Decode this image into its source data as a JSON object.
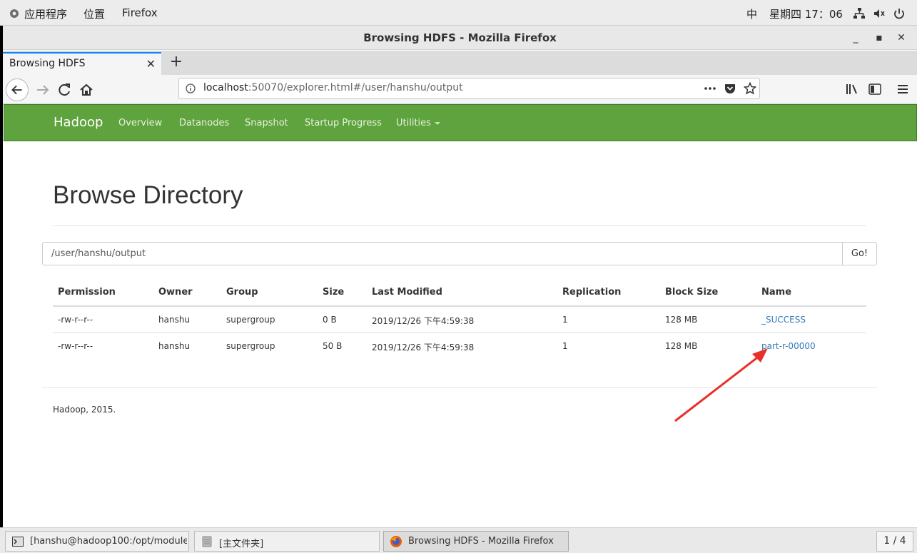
{
  "topbar": {
    "applications": "应用程序",
    "places": "位置",
    "firefox": "Firefox",
    "input_method": "中",
    "clock": "星期四 17：06"
  },
  "window": {
    "title": "Browsing HDFS - Mozilla Firefox",
    "tab_title": "Browsing HDFS",
    "url_host": "localhost",
    "url_rest": ":50070/explorer.html#/user/hanshu/output"
  },
  "hadoop_nav": {
    "brand": "Hadoop",
    "links": [
      "Overview",
      "Datanodes",
      "Snapshot",
      "Startup Progress",
      "Utilities"
    ]
  },
  "main": {
    "title": "Browse Directory",
    "path_value": "/user/hanshu/output",
    "go_label": "Go!",
    "columns": [
      "Permission",
      "Owner",
      "Group",
      "Size",
      "Last Modified",
      "Replication",
      "Block Size",
      "Name"
    ],
    "rows": [
      [
        "-rw-r--r--",
        "hanshu",
        "supergroup",
        "0 B",
        "2019/12/26 下午4:59:38",
        "1",
        "128 MB",
        "_SUCCESS"
      ],
      [
        "-rw-r--r--",
        "hanshu",
        "supergroup",
        "50 B",
        "2019/12/26 下午4:59:38",
        "1",
        "128 MB",
        "part-r-00000"
      ]
    ],
    "footer": "Hadoop, 2015."
  },
  "taskbar": {
    "items": [
      "[hanshu@hadoop100:/opt/module/…",
      "[主文件夹]",
      "Browsing HDFS - Mozilla Firefox"
    ],
    "pager": "1 / 4"
  },
  "colors": {
    "hadoop_green": "#5fa33e",
    "link_blue": "#337ab7",
    "annotation_red": "#e8302a"
  }
}
